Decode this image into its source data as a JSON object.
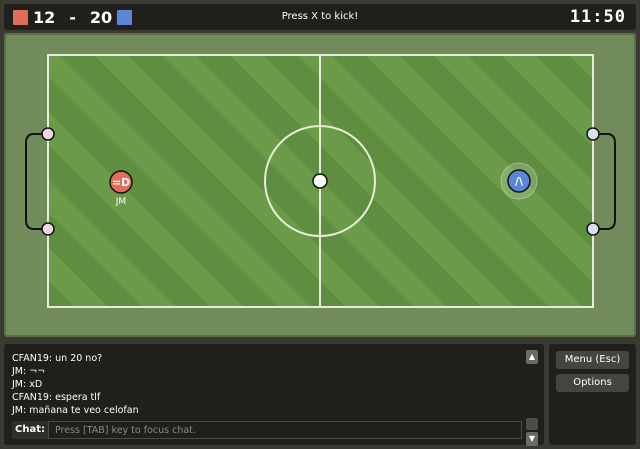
{
  "scoreboard": {
    "red_score": "12",
    "separator": "-",
    "blue_score": "20",
    "red_color": "#e06c5a",
    "blue_color": "#5b85d8"
  },
  "hint": "Press X to kick!",
  "clock": "11:50",
  "field": {
    "grass_color": "#6b9a48",
    "grass_stripe": "#5f8e40",
    "line_color": "#e8ecd8"
  },
  "players": [
    {
      "team": "red",
      "avatar": "=D",
      "name": "JM",
      "color": "#e06c5a"
    },
    {
      "team": "blue",
      "avatar": "/\\",
      "name": "",
      "color": "#5b85d8"
    }
  ],
  "chat": {
    "messages": [
      "CFAN19: un 20 no?",
      "JM: ¬¬",
      "JM: xD",
      "CFAN19: espera tlf",
      "JM: mañana te veo celofan"
    ],
    "label": "Chat:",
    "placeholder": "Press [TAB] key to focus chat.",
    "scroll_up": "▲",
    "scroll_down": "▼"
  },
  "menu": {
    "menu_label": "Menu (Esc)",
    "options_label": "Options"
  }
}
